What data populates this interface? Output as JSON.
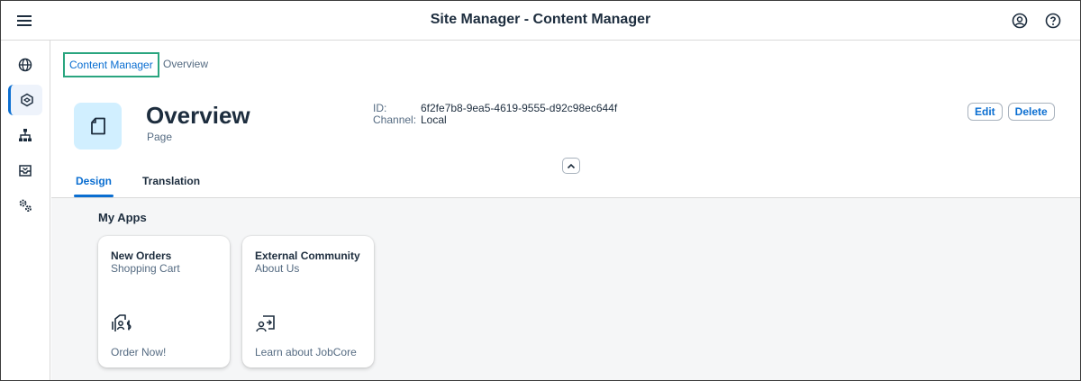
{
  "shell": {
    "title": "Site Manager - Content Manager"
  },
  "icons": {
    "menu": "hamburger-menu-icon",
    "user": "user-profile-icon",
    "help": "help-icon",
    "rail": [
      "globe-icon",
      "content-cube-icon",
      "hierarchy-icon",
      "inbox-icon",
      "settings-gears-icon"
    ],
    "page": "document-page-icon",
    "collapse": "chevron-up-icon",
    "tile1": "shopping-cart-icon",
    "tile2": "user-share-icon"
  },
  "breadcrumb": {
    "link": "Content Manager",
    "current": "Overview"
  },
  "page": {
    "title": "Overview",
    "subtitle": "Page",
    "meta": [
      {
        "label": "ID:",
        "value": "6f2fe7b8-9ea5-4619-9555-d92c98ec644f"
      },
      {
        "label": "Channel:",
        "value": "Local"
      }
    ]
  },
  "actions": {
    "edit": "Edit",
    "delete": "Delete"
  },
  "tabs": [
    {
      "label": "Design",
      "active": true
    },
    {
      "label": "Translation",
      "active": false
    }
  ],
  "section": {
    "title": "My Apps"
  },
  "tiles": [
    {
      "title": "New Orders",
      "subtitle": "Shopping Cart",
      "footer": "Order Now!"
    },
    {
      "title": "External Community",
      "subtitle": "About Us",
      "footer": "Learn about JobCore"
    }
  ],
  "colors": {
    "accent": "#0a6ed1",
    "highlight": "#2aa57f",
    "icon_bg": "#d1efff"
  }
}
